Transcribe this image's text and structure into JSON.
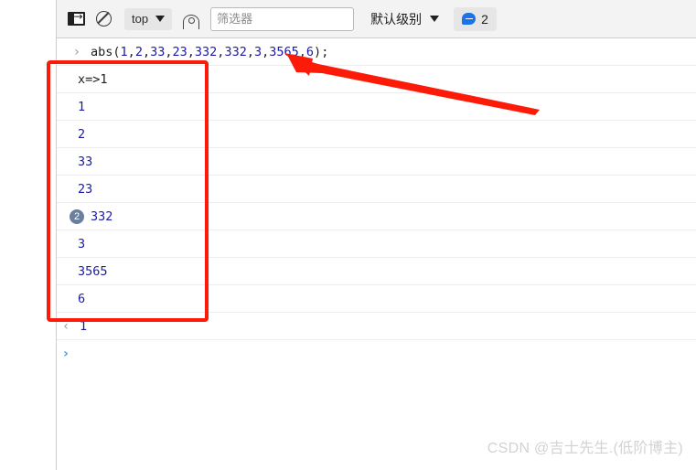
{
  "toolbar": {
    "drawer_icon": "drawer-toggle-icon",
    "clear_icon": "clear-console-icon",
    "context_label": "top",
    "eye_icon": "live-expression-eye-icon",
    "filter_placeholder": "筛选器",
    "filter_value": "",
    "level_label": "默认级别",
    "message_icon": "speech-bubble-icon",
    "message_count": "2"
  },
  "console": {
    "command": {
      "prompt": "›",
      "fn_name": "abs",
      "open_paren": "(",
      "args": [
        "1",
        "2",
        "33",
        "23",
        "332",
        "332",
        "3",
        "3565",
        "6"
      ],
      "close_paren": ")",
      "semicolon": ";",
      "full_text": "abs(1,2,33,23,332,332,3,3565,6);"
    },
    "outputs": [
      {
        "text": "x=>1",
        "kind": "text",
        "count": ""
      },
      {
        "text": "1",
        "kind": "num",
        "count": ""
      },
      {
        "text": "2",
        "kind": "num",
        "count": ""
      },
      {
        "text": "33",
        "kind": "num",
        "count": ""
      },
      {
        "text": "23",
        "kind": "num",
        "count": ""
      },
      {
        "text": "332",
        "kind": "num",
        "count": "2"
      },
      {
        "text": "3",
        "kind": "num",
        "count": ""
      },
      {
        "text": "3565",
        "kind": "num",
        "count": ""
      },
      {
        "text": "6",
        "kind": "num",
        "count": ""
      }
    ],
    "return_value": {
      "marker": "‹",
      "text": "1"
    },
    "input_prompt": "›"
  },
  "annotation": {
    "box_color": "#fb1b08",
    "arrow_color": "#fb1b08"
  },
  "watermark": "CSDN @吉士先生.(低阶博主)"
}
